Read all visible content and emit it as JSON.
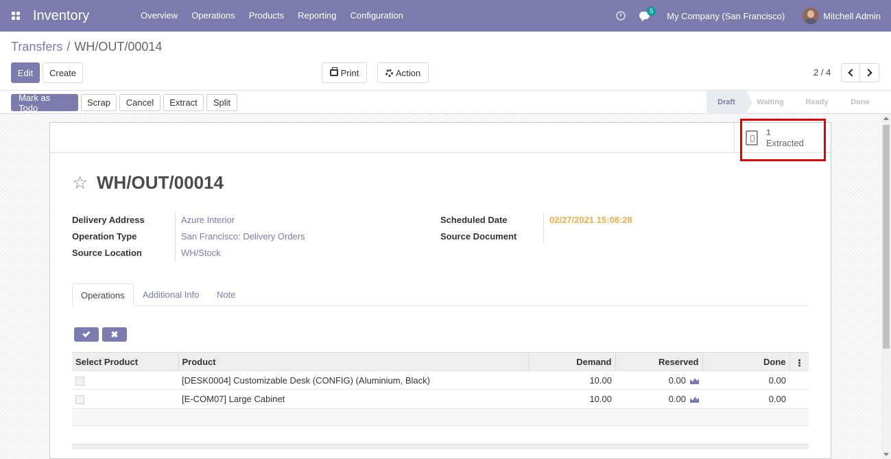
{
  "navbar": {
    "app_name": "Inventory",
    "menu": [
      "Overview",
      "Operations",
      "Products",
      "Reporting",
      "Configuration"
    ],
    "message_count": "5",
    "company": "My Company (San Francisco)",
    "user": "Mitchell Admin"
  },
  "breadcrumb": {
    "parent": "Transfers",
    "separator": "/",
    "current": "WH/OUT/00014"
  },
  "toolbar": {
    "edit": "Edit",
    "create": "Create",
    "print": "Print",
    "action": "Action",
    "pager": "2 / 4"
  },
  "statusbar": {
    "buttons": [
      "Mark as Todo",
      "Scrap",
      "Cancel",
      "Extract",
      "Split"
    ],
    "stages": [
      "Draft",
      "Waiting",
      "Ready",
      "Done"
    ],
    "active_stage": "Draft"
  },
  "smart_button": {
    "value": "1",
    "label": "Extracted"
  },
  "record": {
    "title": "WH/OUT/00014",
    "fields_left": [
      {
        "label": "Delivery Address",
        "value": "Azure Interior"
      },
      {
        "label": "Operation Type",
        "value": "San Francisco: Delivery Orders"
      },
      {
        "label": "Source Location",
        "value": "WH/Stock"
      }
    ],
    "fields_right": [
      {
        "label": "Scheduled Date",
        "value": "02/27/2021 15:08:28"
      },
      {
        "label": "Source Document",
        "value": ""
      }
    ]
  },
  "tabs": [
    "Operations",
    "Additional Info",
    "Note"
  ],
  "operations_table": {
    "columns": [
      "Select Product",
      "Product",
      "Demand",
      "Reserved",
      "Done"
    ],
    "rows": [
      {
        "product": "[DESK0004] Customizable Desk (CONFIG) (Aluminium, Black)",
        "demand": "10.00",
        "reserved": "0.00",
        "done": "0.00"
      },
      {
        "product": "[E-COM07] Large Cabinet",
        "demand": "10.00",
        "reserved": "0.00",
        "done": "0.00"
      }
    ]
  },
  "colors": {
    "brand": "#7c7bad",
    "date": "#f0ad4e",
    "highlight": "#e30000"
  }
}
